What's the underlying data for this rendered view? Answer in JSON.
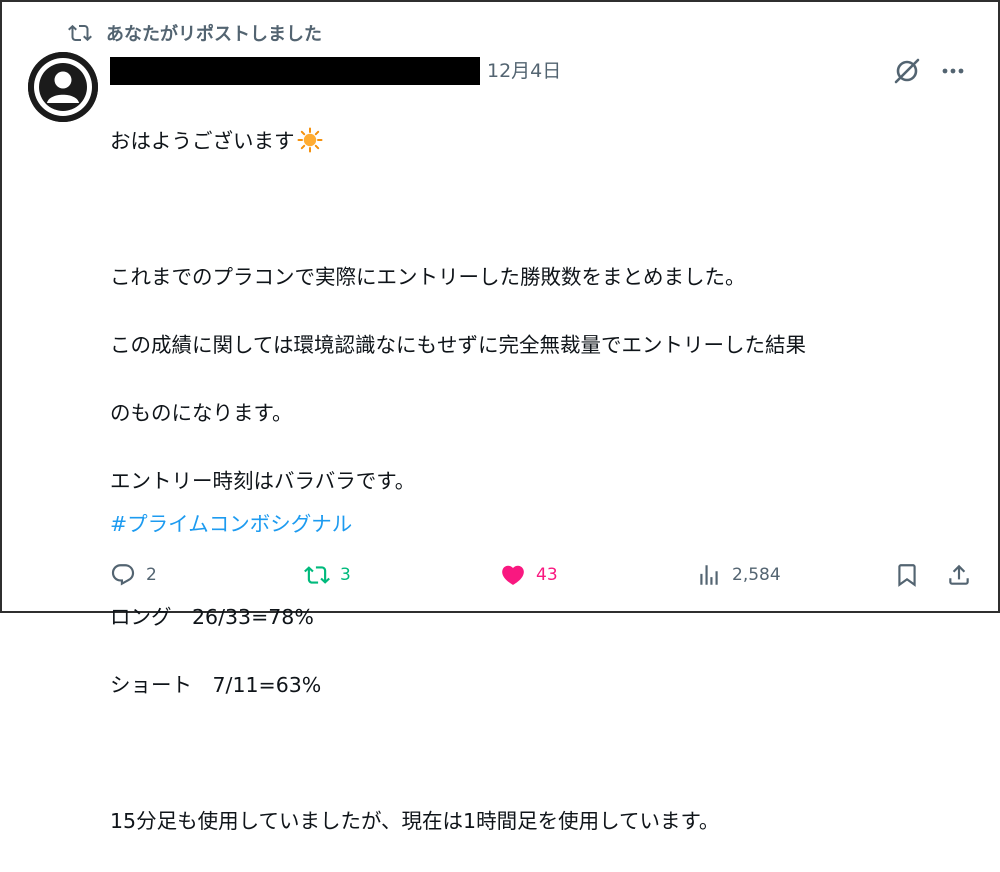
{
  "repost_banner": {
    "text": "あなたがリポストしました",
    "icon": "repost-icon"
  },
  "post": {
    "date": "12月4日",
    "lines": [
      "おはようございます",
      "",
      "これまでのプラコンで実際にエントリーした勝敗数をまとめました。",
      "この成績に関しては環境認識なにもせずに完全無裁量でエントリーした結果",
      "のものになります。",
      "エントリー時刻はバラバラです。",
      "",
      "ロング　26/33=78%",
      "ショート　7/11=63%",
      "",
      "15分足も使用していましたが、現在は1時間足を使用しています。"
    ],
    "hashtag": "#プライムコンボシグナル"
  },
  "actions": {
    "reply_count": "2",
    "repost_count": "3",
    "like_count": "43",
    "views_count": "2,584"
  },
  "colors": {
    "muted": "#536471",
    "repost_active": "#00ba7c",
    "like_active": "#f91880",
    "link": "#1d9bf0"
  }
}
